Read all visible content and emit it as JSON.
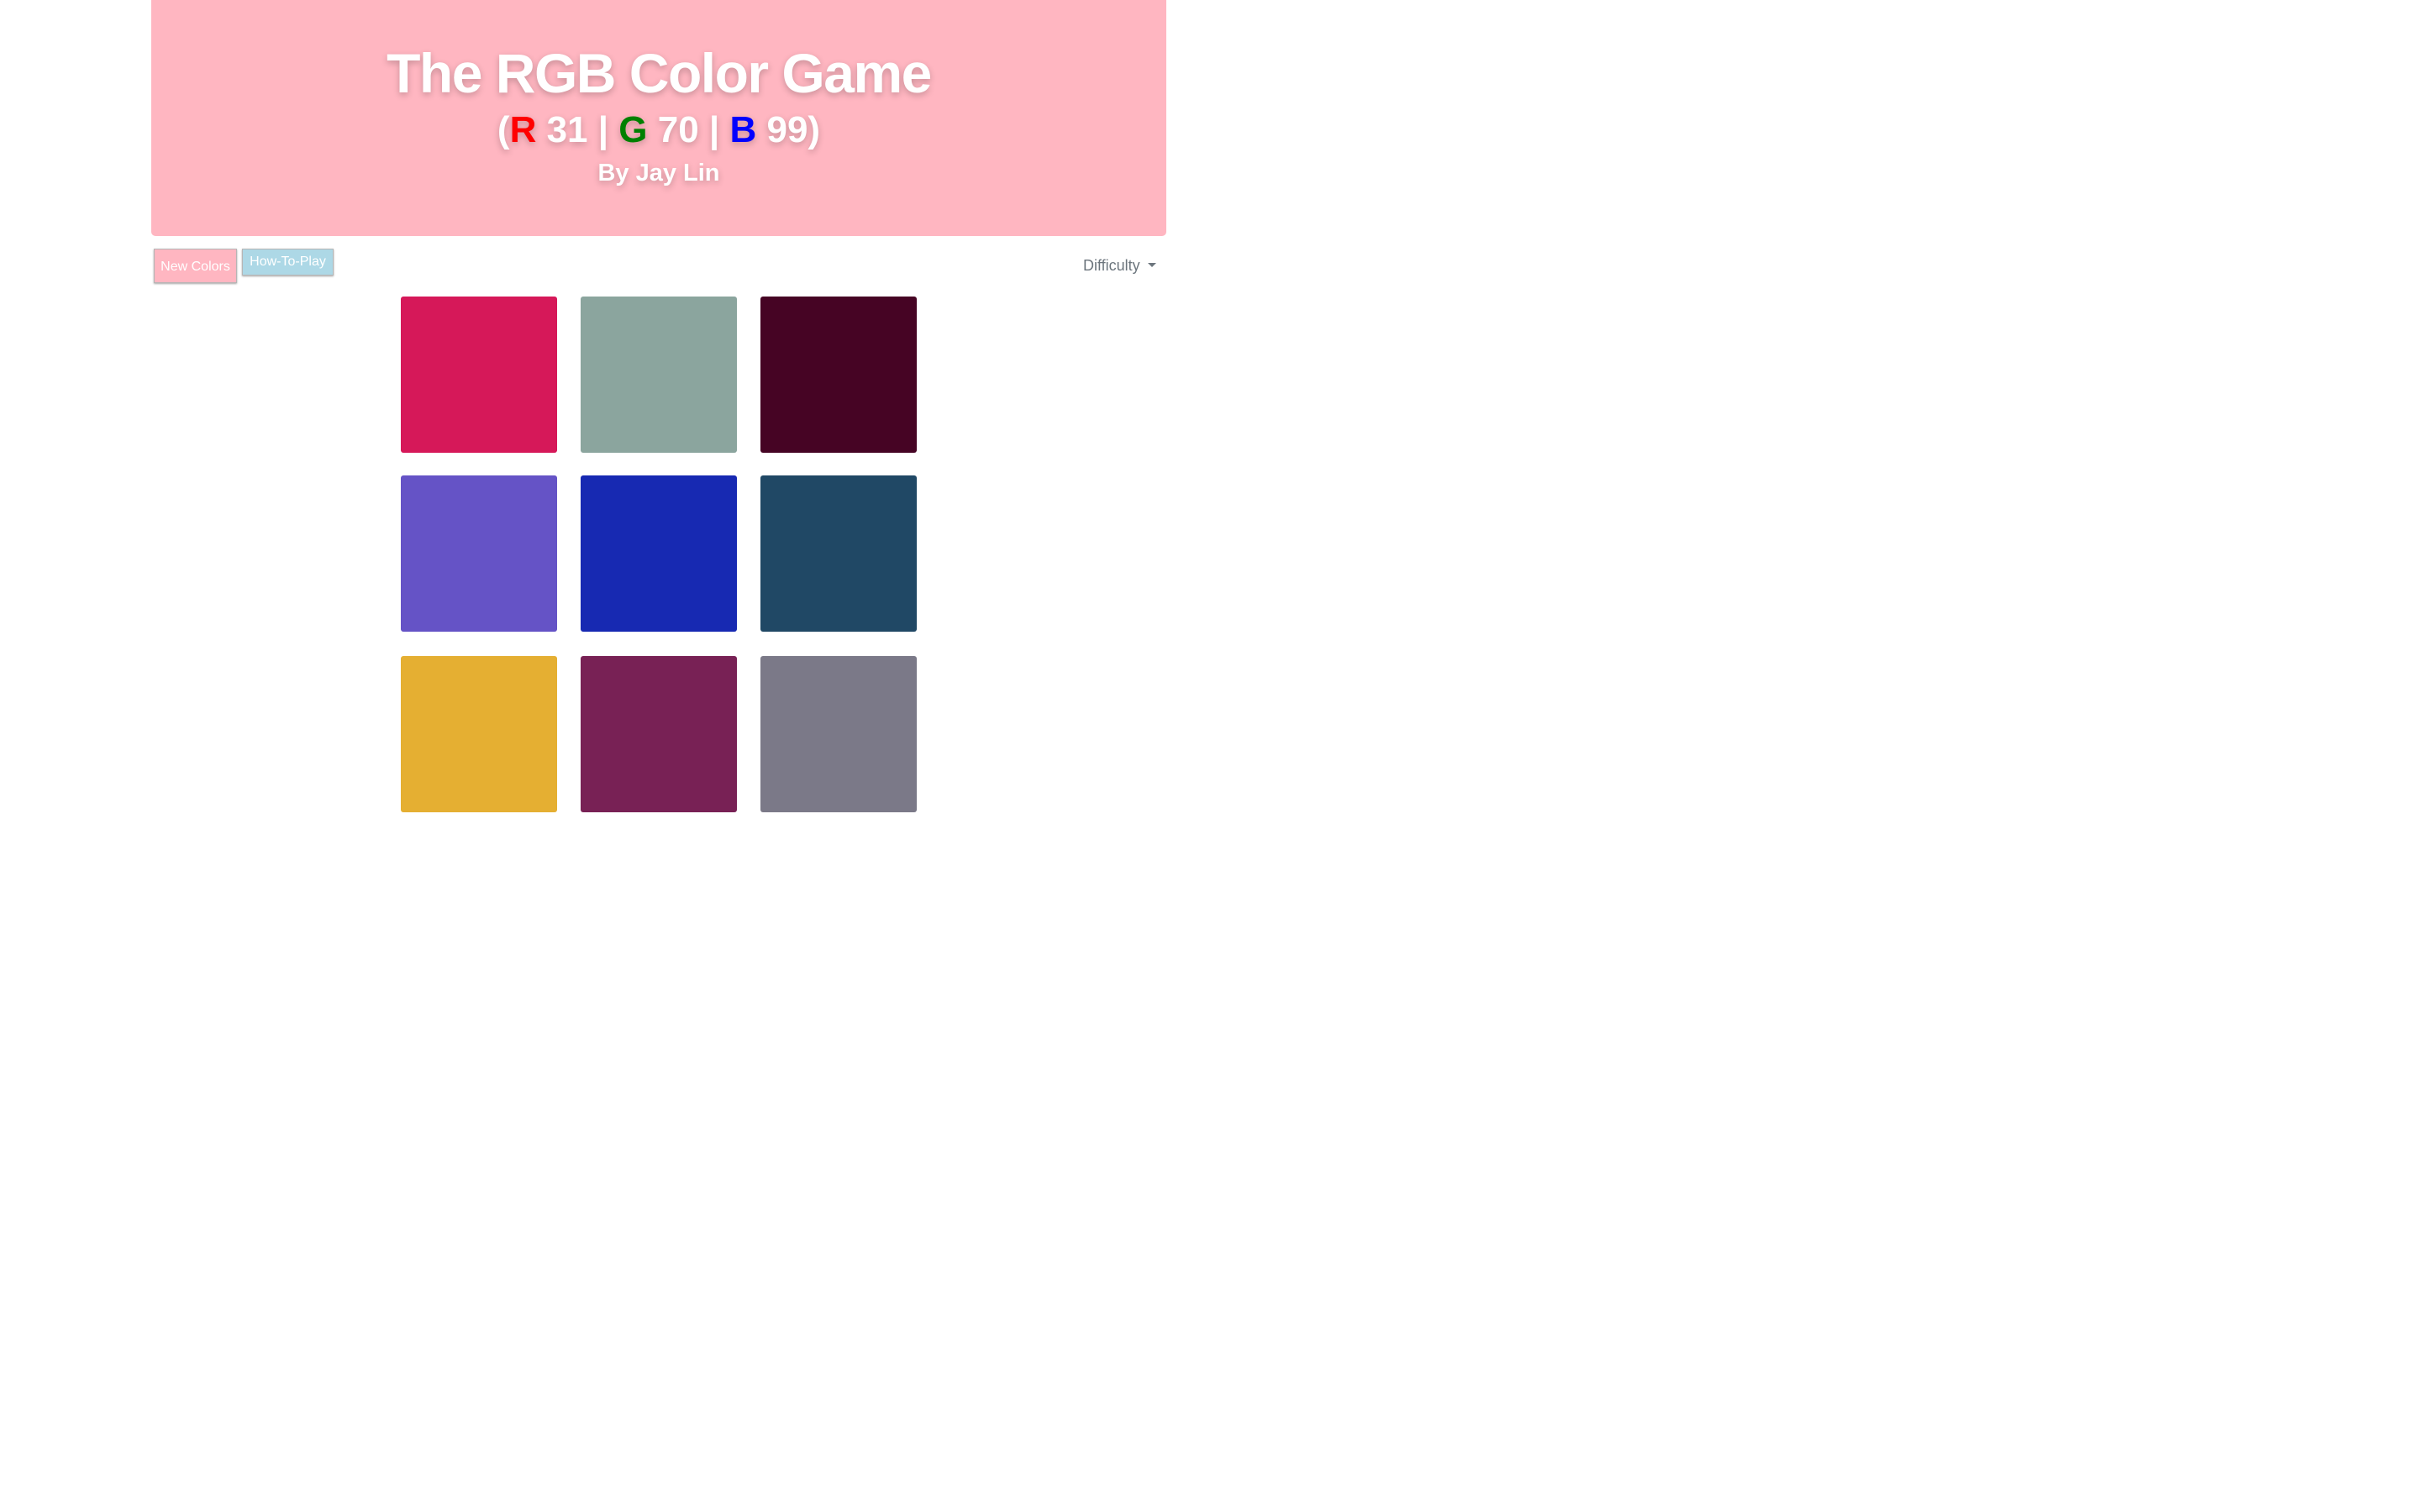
{
  "header": {
    "title": "The RGB Color Game",
    "target": {
      "open_paren": "(",
      "r_letter": "R",
      "r_value": " 31 | ",
      "g_letter": "G",
      "g_value": " 70 | ",
      "b_letter": "B",
      "b_value": " 99",
      "close_paren": ")"
    },
    "author": "By Jay Lin",
    "background_color": "#ffb6c1",
    "letter_colors": {
      "r": "#ff0000",
      "g": "#008000",
      "b": "#0000ff"
    }
  },
  "controls": {
    "new_colors_label": "New Colors",
    "new_colors_color": "#ffb6c1",
    "how_to_play_label": "How-To-Play",
    "how_to_play_color": "#add8e6",
    "difficulty_label": "Difficulty"
  },
  "tiles": [
    {
      "color": "#d61859"
    },
    {
      "color": "#8ba59e"
    },
    {
      "color": "#460424"
    },
    {
      "color": "#6553c6"
    },
    {
      "color": "#1729b2"
    },
    {
      "color": "#204865"
    },
    {
      "color": "#e5af32"
    },
    {
      "color": "#782155"
    },
    {
      "color": "#7b7988"
    }
  ]
}
